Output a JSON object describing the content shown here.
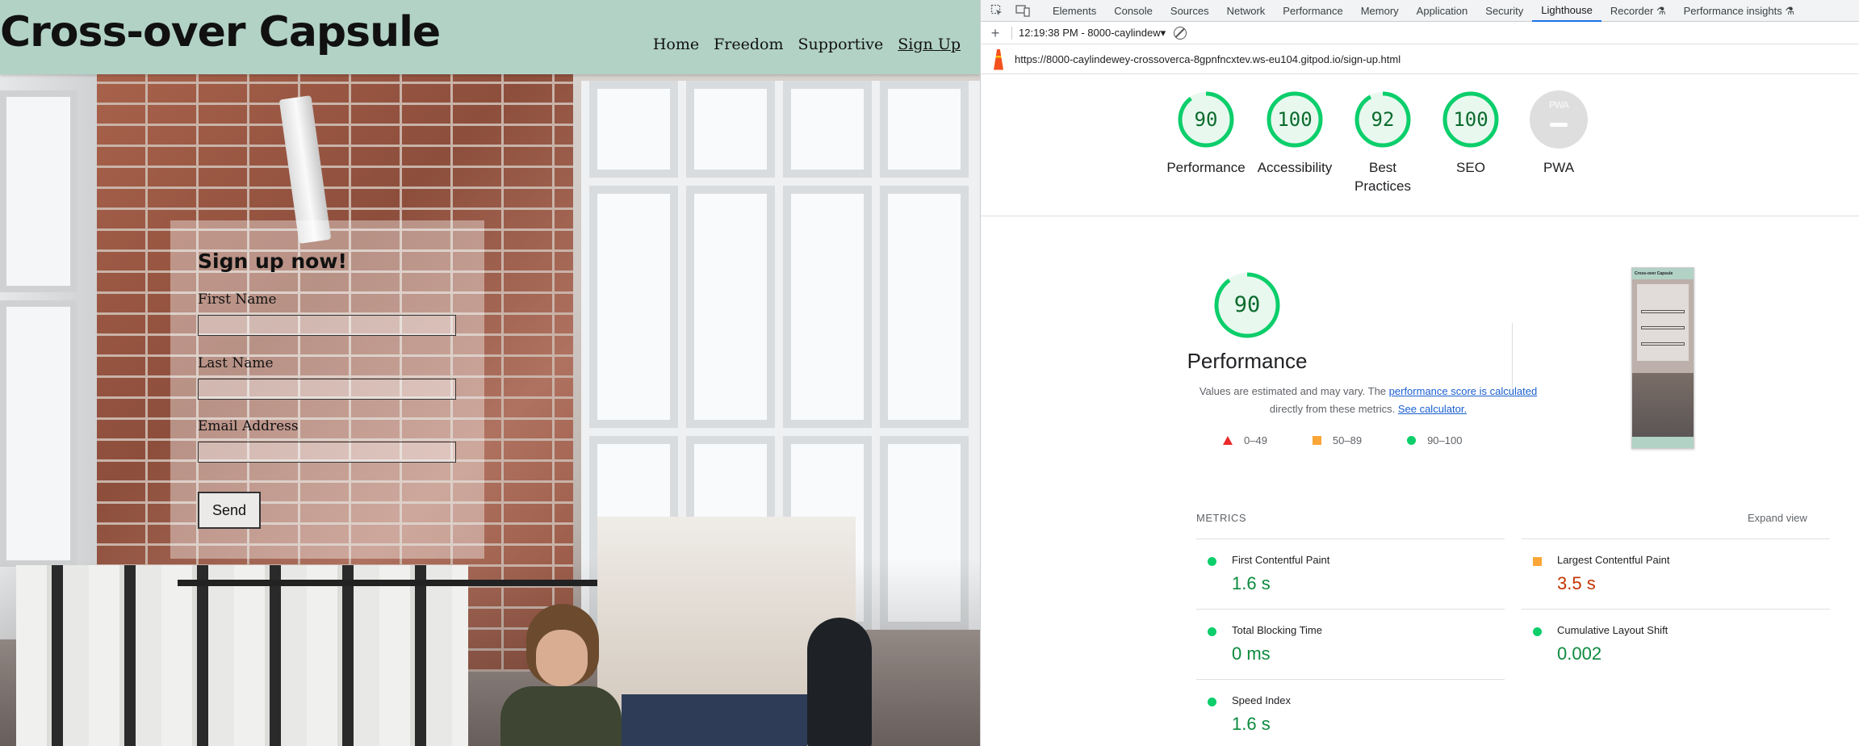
{
  "site": {
    "title": "Cross-over Capsule",
    "nav": [
      "Home",
      "Freedom",
      "Supportive",
      "Sign Up"
    ],
    "form": {
      "heading": "Sign up now!",
      "first_name_label": "First Name",
      "last_name_label": "Last Name",
      "email_label": "Email Address",
      "first_name_value": "",
      "last_name_value": "",
      "email_value": "",
      "send_label": "Send"
    },
    "colors": {
      "header_bg": "#b2d2c6"
    }
  },
  "devtools": {
    "tabs": [
      "Elements",
      "Console",
      "Sources",
      "Network",
      "Performance",
      "Memory",
      "Application",
      "Security",
      "Lighthouse",
      "Recorder ⚗",
      "Performance insights ⚗"
    ],
    "active_tab": "Lighthouse",
    "report_selector": "12:19:38 PM - 8000-caylindew▾",
    "url": "https://8000-caylindewey-crossoverca-8gpnfncxtev.ws-eu104.gitpod.io/sign-up.html",
    "scores": [
      {
        "label": "Performance",
        "value": "90",
        "fraction": 0.9
      },
      {
        "label": "Accessibility",
        "value": "100",
        "fraction": 1.0
      },
      {
        "label": "Best\nPractices",
        "value": "92",
        "fraction": 0.92
      },
      {
        "label": "SEO",
        "value": "100",
        "fraction": 1.0
      },
      {
        "label": "PWA",
        "value": "PWA",
        "fraction": 0
      }
    ],
    "performance": {
      "score": "90",
      "title": "Performance",
      "desc_prefix": "Values are estimated and may vary. The ",
      "link1": "performance score is calculated",
      "desc_middle": " directly from these metrics. ",
      "link2": "See calculator.",
      "legend": [
        "0–49",
        "50–89",
        "90–100"
      ]
    },
    "metrics_heading": "METRICS",
    "expand_label": "Expand view",
    "metrics": [
      {
        "name": "First Contentful Paint",
        "value": "1.6 s",
        "status": "pass"
      },
      {
        "name": "Largest Contentful Paint",
        "value": "3.5 s",
        "status": "average"
      },
      {
        "name": "Total Blocking Time",
        "value": "0 ms",
        "status": "pass"
      },
      {
        "name": "Cumulative Layout Shift",
        "value": "0.002",
        "status": "pass"
      },
      {
        "name": "Speed Index",
        "value": "1.6 s",
        "status": "pass"
      }
    ],
    "thumbnail_title": "Cross-over Capsule",
    "colors": {
      "pass": "#0cce6b",
      "average": "#fba637",
      "fail": "#eb2a2a",
      "link": "#1a5fd0",
      "active_tab": "#1a73e8"
    }
  }
}
